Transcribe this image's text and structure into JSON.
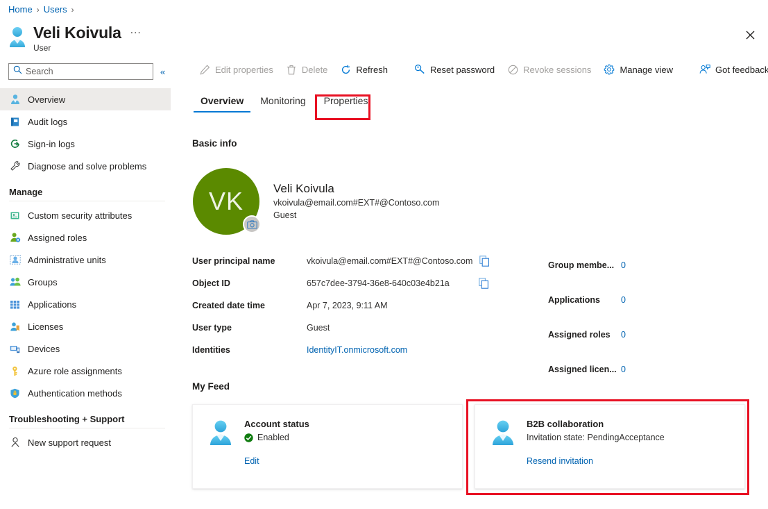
{
  "breadcrumb": {
    "items": [
      "Home",
      "Users"
    ],
    "separator": "›"
  },
  "blade": {
    "title": "Veli Koivula",
    "subtitle": "User",
    "ellipsis": "…",
    "close_label": "Close"
  },
  "search": {
    "placeholder": "Search",
    "value": "",
    "collapse_label": "«"
  },
  "sidebar": {
    "items": [
      {
        "label": "Overview",
        "icon": "user-icon",
        "selected": true
      },
      {
        "label": "Audit logs",
        "icon": "book-icon",
        "selected": false
      },
      {
        "label": "Sign-in logs",
        "icon": "signin-icon",
        "selected": false
      },
      {
        "label": "Diagnose and solve problems",
        "icon": "wrench-icon",
        "selected": false
      }
    ],
    "groups": [
      {
        "title": "Manage",
        "items": [
          {
            "label": "Custom security attributes",
            "icon": "attributes-icon"
          },
          {
            "label": "Assigned roles",
            "icon": "roles-icon"
          },
          {
            "label": "Administrative units",
            "icon": "admin-units-icon"
          },
          {
            "label": "Groups",
            "icon": "groups-icon"
          },
          {
            "label": "Applications",
            "icon": "applications-icon"
          },
          {
            "label": "Licenses",
            "icon": "licenses-icon"
          },
          {
            "label": "Devices",
            "icon": "devices-icon"
          },
          {
            "label": "Azure role assignments",
            "icon": "key-icon"
          },
          {
            "label": "Authentication methods",
            "icon": "shield-icon"
          }
        ]
      },
      {
        "title": "Troubleshooting + Support",
        "items": [
          {
            "label": "New support request",
            "icon": "support-icon"
          }
        ]
      }
    ]
  },
  "toolbar": {
    "commands": [
      {
        "label": "Edit properties",
        "icon": "pencil-icon",
        "disabled": true
      },
      {
        "label": "Delete",
        "icon": "trash-icon",
        "disabled": true
      },
      {
        "label": "Refresh",
        "icon": "refresh-icon",
        "disabled": false
      },
      {
        "separator": true
      },
      {
        "label": "Reset password",
        "icon": "key-search-icon",
        "disabled": false
      },
      {
        "label": "Revoke sessions",
        "icon": "block-icon",
        "disabled": true
      },
      {
        "label": "Manage view",
        "icon": "gear-icon",
        "disabled": false
      },
      {
        "separator": true
      },
      {
        "label": "Got feedback?",
        "icon": "feedback-icon",
        "disabled": false
      }
    ]
  },
  "tabs": [
    {
      "label": "Overview",
      "active": true
    },
    {
      "label": "Monitoring",
      "active": false
    },
    {
      "label": "Properties",
      "active": false,
      "highlighted": true
    }
  ],
  "main": {
    "basic_info_heading": "Basic info",
    "profile": {
      "initials": "VK",
      "avatar_color": "#5b8a00",
      "name": "Veli Koivula",
      "email": "vkoivula@email.com#EXT#@Contoso.com",
      "user_type": "Guest"
    },
    "properties_left": [
      {
        "label": "User principal name",
        "value": "vkoivula@email.com#EXT#@Contoso.com",
        "copy": true,
        "link": false
      },
      {
        "label": "Object ID",
        "value": "657c7dee-3794-36e8-640c03e4b21a",
        "copy": true,
        "link": false
      },
      {
        "label": "Created date time",
        "value": "Apr 7, 2023, 9:11 AM",
        "copy": false,
        "link": false
      },
      {
        "label": "User type",
        "value": "Guest",
        "copy": false,
        "link": false
      },
      {
        "label": "Identities",
        "value": "IdentityIT.onmicrosoft.com",
        "copy": false,
        "link": true
      }
    ],
    "properties_right": [
      {
        "label": "Group membe...",
        "value": "0"
      },
      {
        "label": "Applications",
        "value": "0"
      },
      {
        "label": "Assigned roles",
        "value": "0"
      },
      {
        "label": "Assigned licen...",
        "value": "0"
      }
    ],
    "my_feed_heading": "My Feed",
    "feed_cards": [
      {
        "title": "Account status",
        "status": "Enabled",
        "status_icon": "check-circle-icon",
        "status_color": "#107c10",
        "link": "Edit",
        "highlighted": false
      },
      {
        "title": "B2B collaboration",
        "status": "Invitation state: PendingAcceptance",
        "status_icon": "",
        "status_color": "",
        "link": "Resend invitation",
        "highlighted": true
      }
    ]
  },
  "colors": {
    "accent": "#0078d4",
    "link": "#0063b1",
    "highlight_red": "#e81123",
    "avatar_green": "#5b8a00",
    "success_green": "#107c10"
  }
}
